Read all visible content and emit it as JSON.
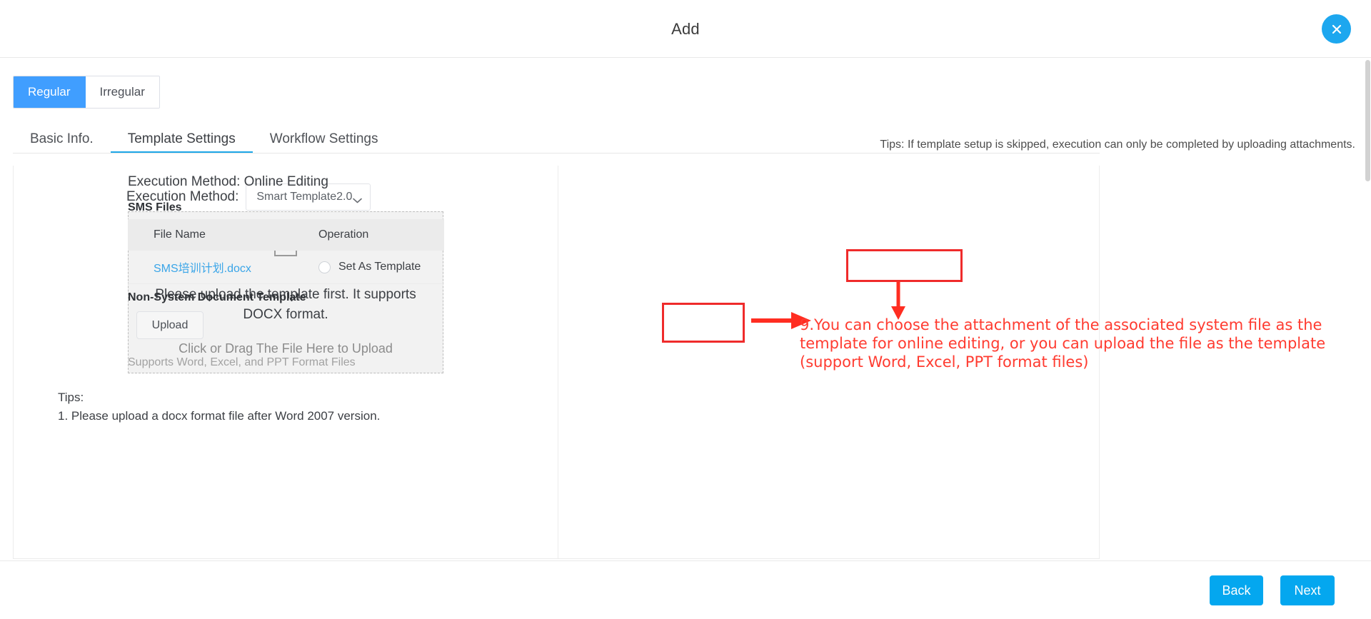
{
  "window": {
    "title": "Add",
    "close_icon": "close-icon"
  },
  "mode_switch": {
    "options": [
      "Regular",
      "Irregular"
    ],
    "selected": "Regular"
  },
  "tabs": {
    "items": [
      "Basic Info.",
      "Template Settings",
      "Workflow Settings"
    ],
    "active": "Template Settings"
  },
  "header_tip": "Tips: If template setup is skipped, execution can only be completed by uploading attachments.",
  "left_panel": {
    "execution_method_label": "Execution Method:",
    "execution_method_value": "Smart Template2.0",
    "dropdown_icon": "chevron-down-icon",
    "dropzone": {
      "icon": "upload-icon",
      "primary_text": "Please upload the template first. It supports DOCX format.",
      "secondary_text": "Click or Drag The File Here to Upload"
    },
    "tips_title": "Tips:",
    "tips_line_1": "1. Please upload a docx format file after Word 2007 version."
  },
  "right_panel": {
    "execution_method": "Execution Method: Online Editing",
    "sms_files_title": "SMS Files",
    "table": {
      "columns": [
        "File Name",
        "Operation"
      ],
      "rows": [
        {
          "file_name": "SMS培训计划.docx",
          "operation": "Set As Template"
        }
      ]
    },
    "non_system_title": "Non-System Document Template",
    "upload_button": "Upload",
    "support_text": "Supports Word, Excel, and PPT Format Files"
  },
  "annotation": {
    "text": "9.You can choose the attachment of the associated system file as the template for online editing, or you can upload the file as the template (support Word, Excel, PPT format files)",
    "color": "#ff3b30",
    "arrow_right_icon": "arrow-right-icon",
    "arrow_down_icon": "arrow-down-icon"
  },
  "footer": {
    "back_label": "Back",
    "next_label": "Next"
  },
  "colors": {
    "primary": "#04a7ef",
    "segment_active": "#409eff",
    "link": "#3aa5e8",
    "annotation_red": "#ff3b30"
  }
}
